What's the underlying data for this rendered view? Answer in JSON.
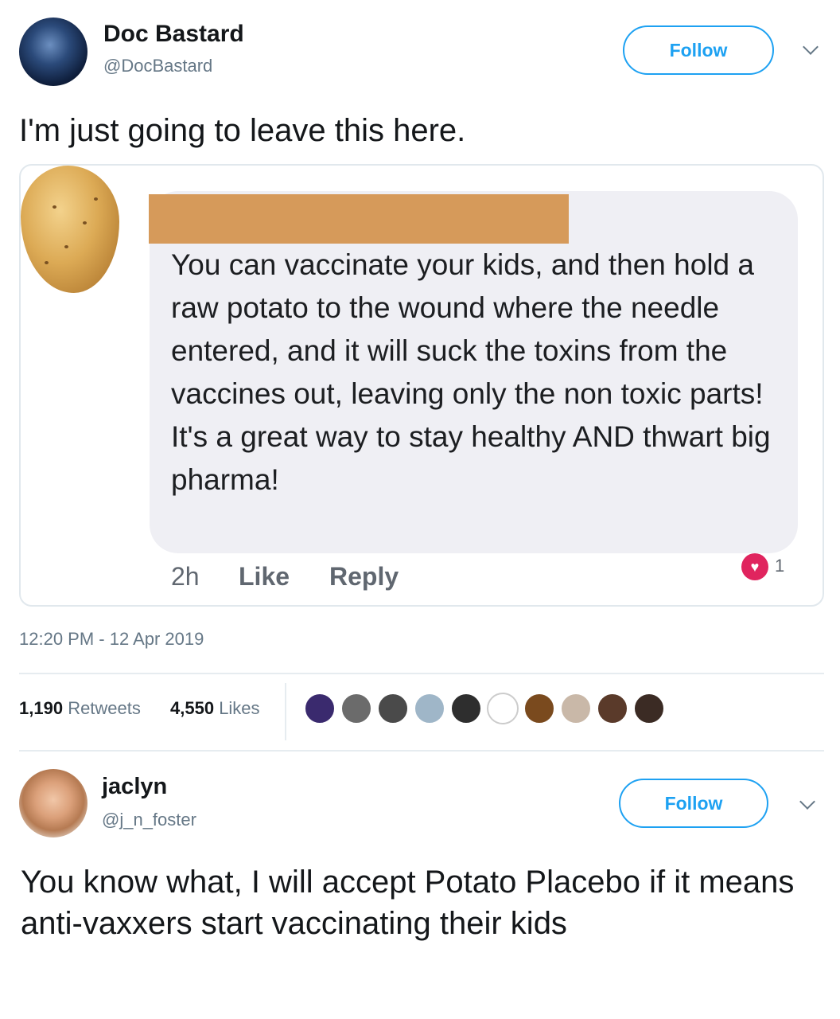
{
  "tweet": {
    "author": {
      "name": "Doc Bastard",
      "handle": "@DocBastard"
    },
    "follow_label": "Follow",
    "text": "I'm just going to leave this here.",
    "embedded_comment": {
      "text": "You can vaccinate your kids, and then hold a raw potato to the wound where the needle entered, and it will suck the toxins from the vaccines out, leaving only the non toxic parts! It's a great way to stay healthy AND thwart big pharma!",
      "time": "2h",
      "like_label": "Like",
      "reply_label": "Reply",
      "reaction_count": "1"
    },
    "timestamp": "12:20 PM - 12 Apr 2019",
    "stats": {
      "retweets_count": "1,190",
      "retweets_label": "Retweets",
      "likes_count": "4,550",
      "likes_label": "Likes"
    }
  },
  "reply": {
    "author": {
      "name": "jaclyn",
      "handle": "@j_n_foster"
    },
    "follow_label": "Follow",
    "text": "You know what, I will accept Potato Placebo if it means anti-vaxxers start vaccinating their kids"
  },
  "colors": {
    "twitter_blue": "#1da1f2",
    "text_primary": "#14171a",
    "text_secondary": "#657786",
    "comment_bubble": "#efeff4",
    "heart_reaction": "#e0245e",
    "redaction": "#d69a5a"
  },
  "icons": [
    "chevron-down-icon",
    "heart-reaction-icon"
  ]
}
